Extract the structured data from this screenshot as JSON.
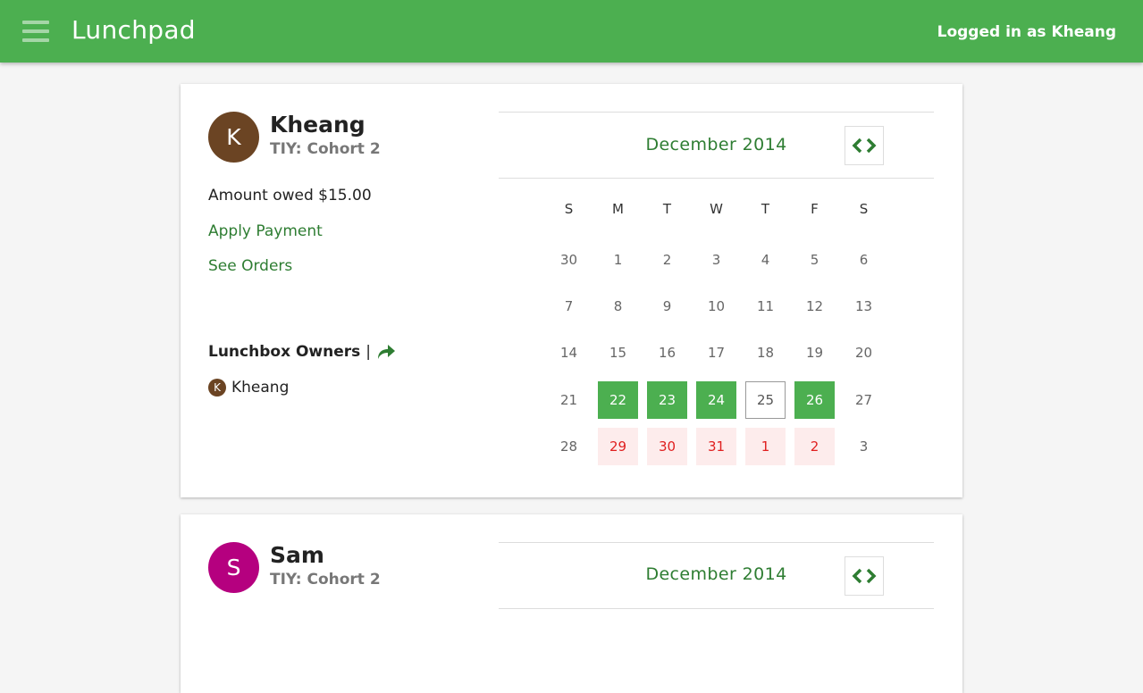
{
  "app": {
    "title": "Lunchpad",
    "login_status": "Logged in as Kheang"
  },
  "colors": {
    "brand": "#4caf50",
    "link": "#2e7d32",
    "owed_bg": "#fdecec",
    "owed_text": "#e02020"
  },
  "icons": {
    "menu": "hamburger-icon",
    "share": "share-arrow-icon",
    "nav": "chevron-left-right-icon"
  },
  "cards": [
    {
      "avatar_letter": "K",
      "avatar_color": "#6b4423",
      "name": "Kheang",
      "cohort": "TIY: Cohort 2",
      "amount_owed": "Amount owed $15.00",
      "apply_payment": "Apply Payment",
      "see_orders": "See Orders",
      "owners_title": "Lunchbox Owners",
      "owners_sep": "|",
      "owners": [
        {
          "initial": "K",
          "name": "Kheang"
        }
      ],
      "calendar": {
        "month_label": "December 2014",
        "weekdays": [
          "S",
          "M",
          "T",
          "W",
          "T",
          "F",
          "S"
        ],
        "weeks": [
          [
            {
              "d": "30",
              "s": "plain"
            },
            {
              "d": "1",
              "s": "plain"
            },
            {
              "d": "2",
              "s": "plain"
            },
            {
              "d": "3",
              "s": "plain"
            },
            {
              "d": "4",
              "s": "plain"
            },
            {
              "d": "5",
              "s": "plain"
            },
            {
              "d": "6",
              "s": "plain"
            }
          ],
          [
            {
              "d": "7",
              "s": "plain"
            },
            {
              "d": "8",
              "s": "plain"
            },
            {
              "d": "9",
              "s": "plain"
            },
            {
              "d": "10",
              "s": "plain"
            },
            {
              "d": "11",
              "s": "plain"
            },
            {
              "d": "12",
              "s": "plain"
            },
            {
              "d": "13",
              "s": "plain"
            }
          ],
          [
            {
              "d": "14",
              "s": "plain"
            },
            {
              "d": "15",
              "s": "plain"
            },
            {
              "d": "16",
              "s": "plain"
            },
            {
              "d": "17",
              "s": "plain"
            },
            {
              "d": "18",
              "s": "plain"
            },
            {
              "d": "19",
              "s": "plain"
            },
            {
              "d": "20",
              "s": "plain"
            }
          ],
          [
            {
              "d": "21",
              "s": "plain"
            },
            {
              "d": "22",
              "s": "ordered"
            },
            {
              "d": "23",
              "s": "ordered"
            },
            {
              "d": "24",
              "s": "ordered"
            },
            {
              "d": "25",
              "s": "today"
            },
            {
              "d": "26",
              "s": "ordered"
            },
            {
              "d": "27",
              "s": "plain"
            }
          ],
          [
            {
              "d": "28",
              "s": "plain"
            },
            {
              "d": "29",
              "s": "owed"
            },
            {
              "d": "30",
              "s": "owed"
            },
            {
              "d": "31",
              "s": "owed"
            },
            {
              "d": "1",
              "s": "owed"
            },
            {
              "d": "2",
              "s": "owed"
            },
            {
              "d": "3",
              "s": "plain"
            }
          ]
        ]
      }
    },
    {
      "avatar_letter": "S",
      "avatar_color": "#b5007f",
      "name": "Sam",
      "cohort": "TIY: Cohort 2",
      "calendar": {
        "month_label": "December 2014"
      }
    }
  ]
}
